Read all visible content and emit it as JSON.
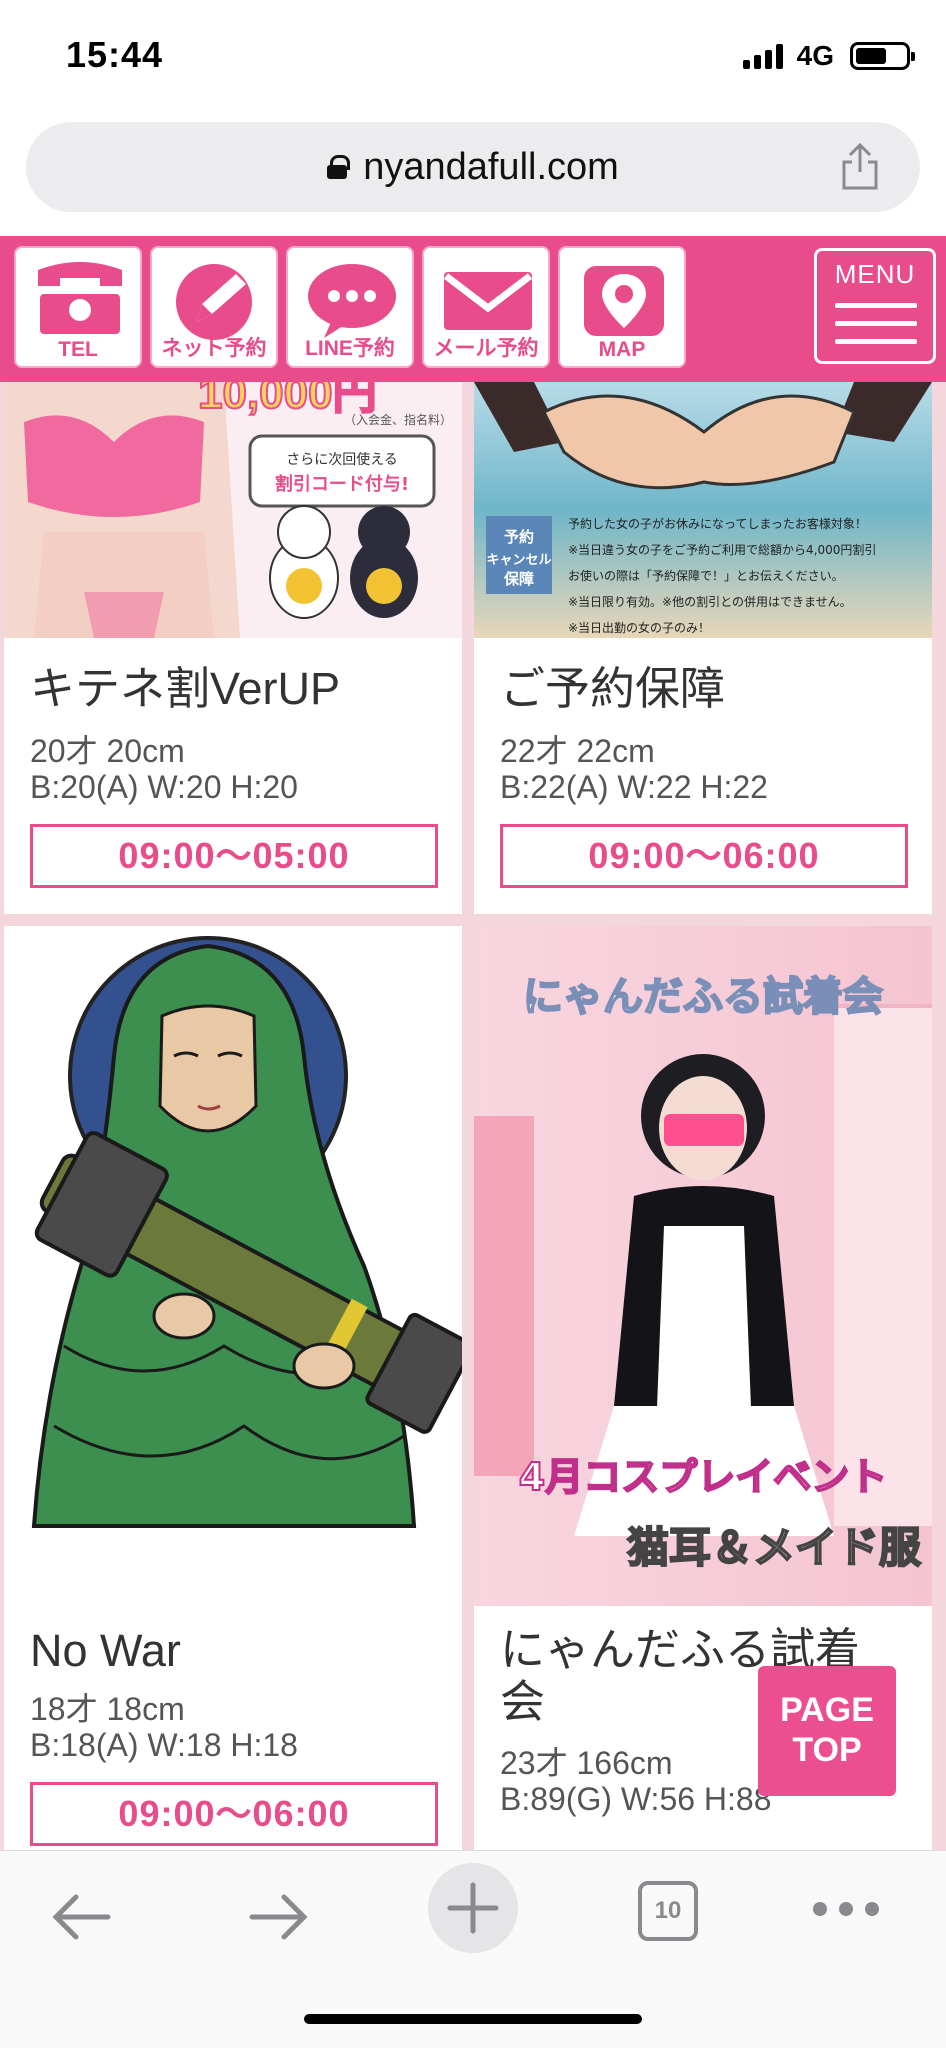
{
  "status": {
    "time": "15:44",
    "network": "4G"
  },
  "browser": {
    "url": "nyandafull.com",
    "tab_count": "10"
  },
  "header": {
    "buttons": [
      {
        "label": "TEL",
        "icon": "telephone-icon"
      },
      {
        "label": "ネット予約",
        "icon": "pencil-icon"
      },
      {
        "label": "LINE予約",
        "icon": "chat-bubble-icon"
      },
      {
        "label": "メール予約",
        "icon": "envelope-icon"
      },
      {
        "label": "MAP",
        "icon": "map-pin-icon"
      }
    ],
    "menu_label": "MENU"
  },
  "cards": [
    {
      "title": "キテネ割VerUP",
      "line1": "20才 20cm",
      "line2": "B:20(A) W:20 H:20",
      "hours": "09:00〜05:00",
      "image": {
        "price": "10,000円",
        "sub": "（入会金、指名料）",
        "code_text_1": "さらに次回使える",
        "code_text_2": "割引コード付与!"
      }
    },
    {
      "title": "ご予約保障",
      "line1": "22才 22cm",
      "line2": "B:22(A) W:22 H:22",
      "hours": "09:00〜06:00",
      "image": {
        "badge": "予約キャンセル保障",
        "lines": [
          "予約した女の子がお休みになってしまったお客様対象！",
          "※当日違う女の子をご予約ご利用で総額から4,000円割引",
          "お使いの際は「予約保障で！」とお伝えください。",
          "※当日限り有効。※他の割引との併用はできません。",
          "※当日出勤の女の子のみ！"
        ]
      }
    },
    {
      "title": "No War",
      "line1": "18才 18cm",
      "line2": "B:18(A) W:18 H:18",
      "hours": "09:00〜06:00"
    },
    {
      "title": "にゃんだふる試着会",
      "line1": "23才 166cm",
      "line2": "B:89(G) W:56 H:88",
      "image": {
        "headline": "にゃんだふる試着会",
        "event": "4月コスプレイベント",
        "sub": "猫耳＆メイド服"
      }
    }
  ],
  "page_top": {
    "line1": "PAGE",
    "line2": "TOP"
  },
  "colors": {
    "brand_pink": "#e94c8b",
    "background_pink": "#f3d7dd"
  }
}
